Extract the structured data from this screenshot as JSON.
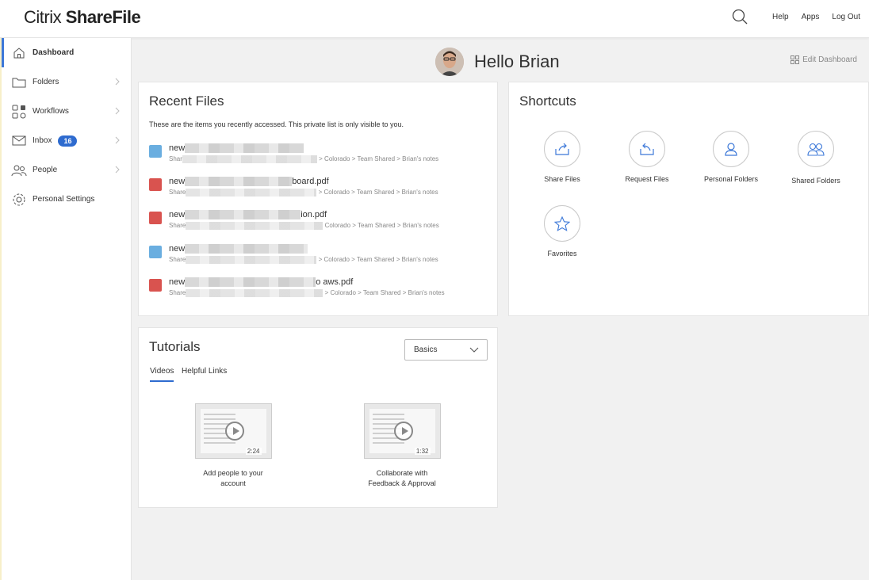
{
  "brand": {
    "light": "Citrix ",
    "bold": "ShareFile"
  },
  "topnav": {
    "help": "Help",
    "apps": "Apps",
    "logout": "Log Out"
  },
  "sidebar": {
    "items": [
      {
        "label": "Dashboard",
        "icon": "home-icon"
      },
      {
        "label": "Folders",
        "icon": "folder-icon"
      },
      {
        "label": "Workflows",
        "icon": "workflows-icon"
      },
      {
        "label": "Inbox",
        "icon": "mail-icon",
        "badge": "16"
      },
      {
        "label": "People",
        "icon": "people-icon"
      },
      {
        "label": "Personal Settings",
        "icon": "gear-icon"
      }
    ]
  },
  "greeting": {
    "text": "Hello Brian",
    "edit": "Edit Dashboard"
  },
  "recent": {
    "title": "Recent Files",
    "desc": "These are the items you recently accessed. This private list is only visible to you.",
    "files": [
      {
        "name_start": "new",
        "name_end": "",
        "path_start": "Shar",
        "path_end": "> Colorado > Team Shared > Brian's notes",
        "type": "image"
      },
      {
        "name_start": "new",
        "name_end": "board.pdf",
        "path_start": "Share",
        "path_end": "> Colorado > Team Shared > Brian's notes",
        "type": "pdf"
      },
      {
        "name_start": "new",
        "name_end": "ion.pdf",
        "path_start": "Share",
        "path_end": "Colorado > Team Shared > Brian's notes",
        "type": "pdf"
      },
      {
        "name_start": "new",
        "name_end": "",
        "path_start": "Share",
        "path_end": "> Colorado > Team Shared > Brian's notes",
        "type": "image"
      },
      {
        "name_start": "new",
        "name_end": "o aws.pdf",
        "path_start": "Share",
        "path_end": "> Colorado > Team Shared > Brian's notes",
        "type": "pdf"
      }
    ]
  },
  "shortcuts": {
    "title": "Shortcuts",
    "items": [
      {
        "label": "Share Files",
        "icon": "share-files-icon"
      },
      {
        "label": "Request Files",
        "icon": "request-files-icon"
      },
      {
        "label": "Personal Folders",
        "icon": "person-icon"
      },
      {
        "label": "Shared Folders",
        "icon": "group-icon"
      },
      {
        "label": "Favorites",
        "icon": "star-icon"
      }
    ]
  },
  "tutorials": {
    "title": "Tutorials",
    "select": "Basics",
    "tabs": [
      "Videos",
      "Helpful Links"
    ],
    "videos": [
      {
        "duration": "2:24",
        "line1": "Add people to your",
        "line2": "account"
      },
      {
        "duration": "1:32",
        "line1": "Collaborate with",
        "line2": "Feedback & Approval"
      }
    ]
  }
}
